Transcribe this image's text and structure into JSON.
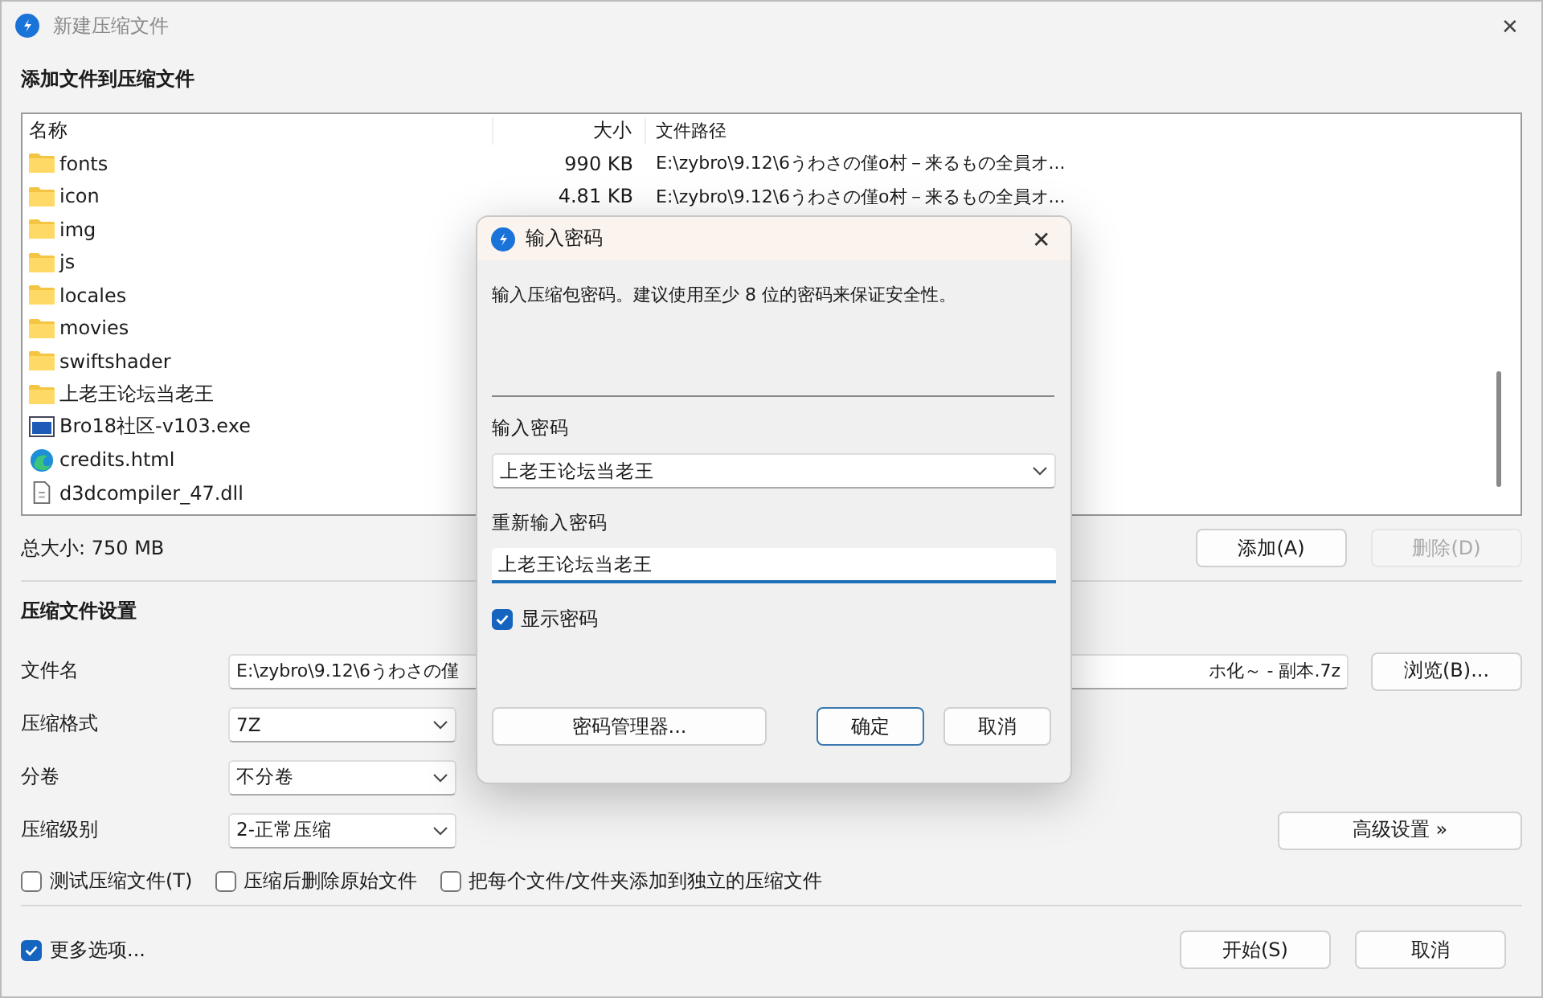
{
  "window": {
    "title": "新建压缩文件",
    "active": false,
    "close": "✕"
  },
  "section_add": "添加文件到压缩文件",
  "file_list": {
    "columns": [
      "名称",
      "大小",
      "文件路径"
    ],
    "rows": [
      {
        "kind": "folder",
        "name": "fonts",
        "size": "990 KB",
        "path": "E:\\zybro\\9.12\\6うわさの僅o村－来るもの全員オ..."
      },
      {
        "kind": "folder",
        "name": "icon",
        "size": "4.81 KB",
        "path": "E:\\zybro\\9.12\\6うわさの僅o村－来るもの全員オ..."
      },
      {
        "kind": "folder",
        "name": "img"
      },
      {
        "kind": "folder",
        "name": "js"
      },
      {
        "kind": "folder",
        "name": "locales"
      },
      {
        "kind": "folder",
        "name": "movies"
      },
      {
        "kind": "folder",
        "name": "swiftshader"
      },
      {
        "kind": "folder",
        "name": "上老王论坛当老王"
      },
      {
        "kind": "exe",
        "name": "Bro18社区-v103.exe"
      },
      {
        "kind": "html",
        "name": "credits.html"
      },
      {
        "kind": "dll",
        "name": "d3dcompiler_47.dll"
      }
    ]
  },
  "total_size": "总大小: 750 MB",
  "list_buttons": [
    {
      "label": "添加(A)",
      "disabled": false
    },
    {
      "label": "删除(D)",
      "disabled": true
    }
  ],
  "section_settings": "压缩文件设置",
  "filename": {
    "label": "文件名",
    "value_start": "E:\\zybro\\9.12\\6うわさの僅",
    "value_end": "ホ化～ - 副本.7z",
    "browse": "浏览(B)..."
  },
  "format": {
    "label": "压缩格式",
    "value": "7Z"
  },
  "volume": {
    "label": "分卷",
    "value": "不分卷"
  },
  "level": {
    "label": "压缩级别",
    "value": "2-正常压缩",
    "advanced": "高级设置 »"
  },
  "options": [
    {
      "label": "测试压缩文件(T)",
      "checked": false
    },
    {
      "label": "压缩后删除原始文件",
      "checked": false
    },
    {
      "label": "把每个文件/文件夹添加到独立的压缩文件",
      "checked": false
    }
  ],
  "more_options": {
    "label": "更多选项...",
    "checked": true
  },
  "footer_buttons": [
    "开始(S)",
    "取消"
  ],
  "password_dialog": {
    "title": "输入密码",
    "close": "✕",
    "message": "输入压缩包密码。建议使用至少 8 位的密码来保证安全性。",
    "password_label": "输入密码",
    "password_value": "上老王论坛当老王",
    "confirm_label": "重新输入密码",
    "confirm_value": "上老王论坛当老王",
    "show_password": {
      "label": "显示密码",
      "checked": true
    },
    "buttons": [
      {
        "label": "密码管理器...",
        "default": false
      },
      {
        "label": "确定",
        "default": true
      },
      {
        "label": "取消",
        "default": false
      }
    ]
  }
}
